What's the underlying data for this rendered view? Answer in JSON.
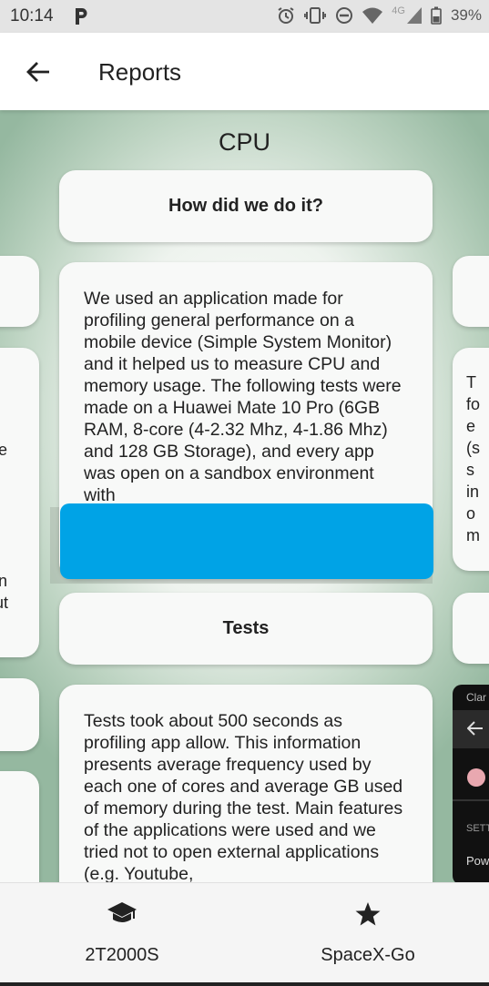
{
  "status_bar": {
    "time": "10:14",
    "network": "4G",
    "battery": "39%",
    "icons": [
      "parking-icon",
      "alarm-icon",
      "vibrate-icon",
      "do-not-disturb-icon",
      "wifi-icon",
      "signal-icon",
      "battery-icon"
    ]
  },
  "app_bar": {
    "title": "Reports",
    "back_icon": "arrow-back-icon"
  },
  "page": {
    "heading": "CPU",
    "cards": {
      "how_heading": "How did we do it?",
      "how_body": "We used an application made for profiling general performance on a mobile device (Simple System Monitor) and it helped us to measure CPU and memory usage. The following tests were made on a Huawei Mate 10 Pro (6GB RAM, 8-core (4-2.32 Mhz, 4-1.86 Mhz) and 128 GB Storage), and every app was open on a sandbox environment with",
      "tests_heading": "Tests",
      "tests_body": "Tests took about 500 seconds as profiling app allow. This information presents average frequency used by each one of cores and average GB used of memory during the test. Main features of the applications were used and we tried not to open external applications (e.g. Youtube,"
    },
    "left_peek": {
      "fragment_a": "e",
      "fragment_b": "n",
      "fragment_c": "ut"
    },
    "right_peek": {
      "lines": [
        "T",
        "fo",
        "e",
        "(s",
        "s",
        "in",
        "o",
        "m"
      ]
    },
    "phone_thumb": {
      "header": "Clar",
      "section": "SETT",
      "item": "Pow"
    }
  },
  "bottom_nav": {
    "items": [
      {
        "label": "2T2000S",
        "icon": "graduation-cap-icon"
      },
      {
        "label": "SpaceX-Go",
        "icon": "star-icon"
      }
    ]
  },
  "colors": {
    "redaction": "#00a3e6",
    "background_green": "#95b8a0"
  }
}
